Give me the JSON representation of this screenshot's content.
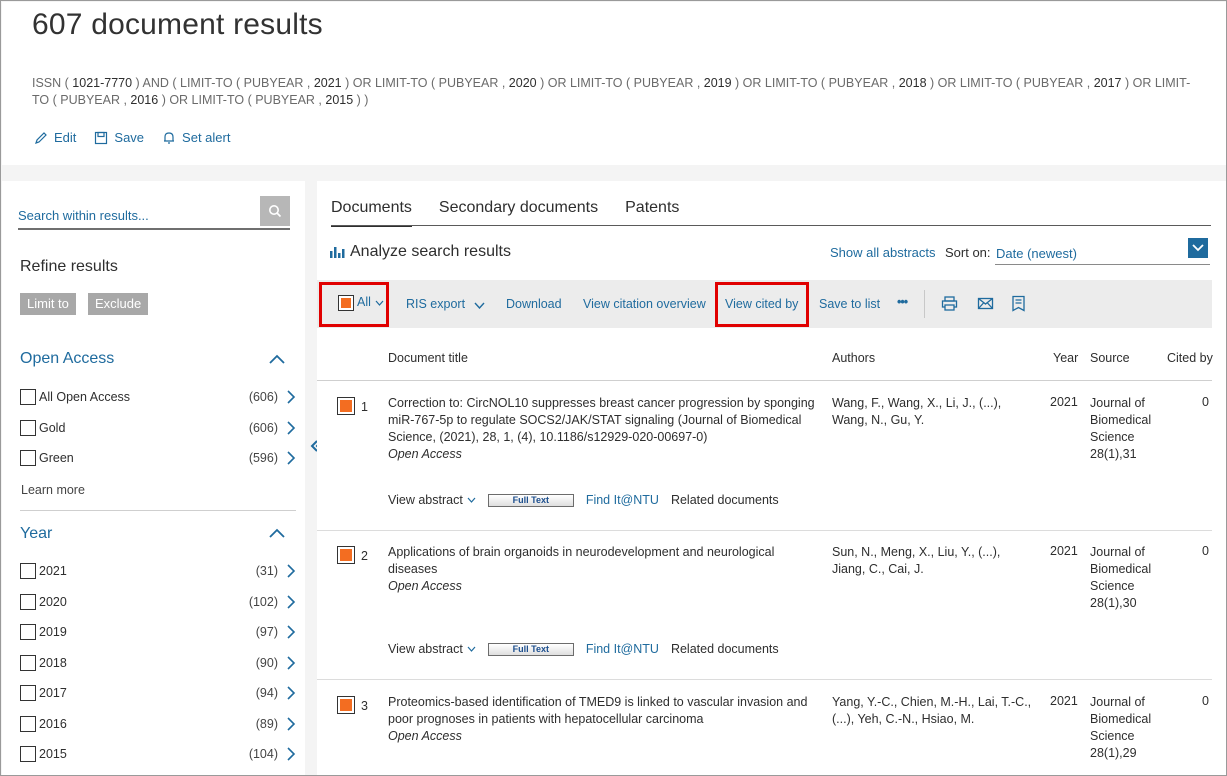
{
  "header": {
    "title": "607 document results",
    "query_parts": [
      {
        "text": "ISSN ( ",
        "strong": false
      },
      {
        "text": "1021-7770",
        "strong": true
      },
      {
        "text": " )  AND  ( LIMIT-TO ( PUBYEAR , ",
        "strong": false
      },
      {
        "text": "2021",
        "strong": true
      },
      {
        "text": " )  OR  LIMIT-TO ( PUBYEAR , ",
        "strong": false
      },
      {
        "text": "2020",
        "strong": true
      },
      {
        "text": " )  OR  LIMIT-TO ( PUBYEAR , ",
        "strong": false
      },
      {
        "text": "2019",
        "strong": true
      },
      {
        "text": " )  OR  LIMIT-TO ( PUBYEAR , ",
        "strong": false
      },
      {
        "text": "2018",
        "strong": true
      },
      {
        "text": " )  OR  LIMIT-TO ( PUBYEAR , ",
        "strong": false
      },
      {
        "text": "2017",
        "strong": true
      },
      {
        "text": " )  OR  LIMIT-TO ( PUBYEAR , ",
        "strong": false
      },
      {
        "text": "2016",
        "strong": true
      },
      {
        "text": " )  OR  LIMIT-TO ( PUBYEAR , ",
        "strong": false
      },
      {
        "text": "2015",
        "strong": true
      },
      {
        "text": " ) )",
        "strong": false
      }
    ],
    "actions": {
      "edit": "Edit",
      "save": "Save",
      "alert": "Set alert"
    }
  },
  "sidebar": {
    "search_placeholder": "Search within results...",
    "refine_title": "Refine results",
    "limit_label": "Limit to",
    "exclude_label": "Exclude",
    "open_access": {
      "title": "Open Access",
      "items": [
        {
          "label": "All Open Access",
          "count": "(606)"
        },
        {
          "label": "Gold",
          "count": "(606)"
        },
        {
          "label": "Green",
          "count": "(596)"
        }
      ],
      "learn_more": "Learn more"
    },
    "year": {
      "title": "Year",
      "items": [
        {
          "label": "2021",
          "count": "(31)"
        },
        {
          "label": "2020",
          "count": "(102)"
        },
        {
          "label": "2019",
          "count": "(97)"
        },
        {
          "label": "2018",
          "count": "(90)"
        },
        {
          "label": "2017",
          "count": "(94)"
        },
        {
          "label": "2016",
          "count": "(89)"
        },
        {
          "label": "2015",
          "count": "(104)"
        }
      ]
    }
  },
  "main": {
    "tabs": [
      "Documents",
      "Secondary documents",
      "Patents"
    ],
    "analyze": "Analyze search results",
    "show_all_abstracts": "Show all abstracts",
    "sort_label": "Sort on:",
    "sort_value": "Date (newest)",
    "toolbar": {
      "all": "All",
      "ris_export": "RIS export",
      "download": "Download",
      "view_citation_overview": "View citation overview",
      "view_cited_by": "View cited by",
      "save_to_list": "Save to list",
      "more": "•••"
    },
    "columns": {
      "title": "Document title",
      "authors": "Authors",
      "year": "Year",
      "source": "Source",
      "cited_by": "Cited by"
    },
    "row_actions": {
      "view_abstract": "View abstract",
      "full_text": "Full Text",
      "find_it": "Find It@NTU",
      "related": "Related documents"
    },
    "results": [
      {
        "num": "1",
        "title": "Correction to: CircNOL10 suppresses breast cancer progression by sponging miR-767-5p to regulate SOCS2/JAK/STAT signaling (Journal of Biomedical Science, (2021), 28, 1, (4), 10.1186/s12929-020-00697-0)",
        "open_access": "Open Access",
        "authors": "Wang, F., Wang, X., Li, J., (...), Wang, N., Gu, Y.",
        "year": "2021",
        "source": "Journal of Biomedical Science 28(1),31",
        "cited_by": "0"
      },
      {
        "num": "2",
        "title": "Applications of brain organoids in neurodevelopment and neurological diseases",
        "open_access": "Open Access",
        "authors": "Sun, N., Meng, X., Liu, Y., (...), Jiang, C., Cai, J.",
        "year": "2021",
        "source": "Journal of Biomedical Science 28(1),30",
        "cited_by": "0"
      },
      {
        "num": "3",
        "title": "Proteomics-based identification of TMED9 is linked to vascular invasion and poor prognoses in patients with hepatocellular carcinoma",
        "open_access": "Open Access",
        "authors": "Yang, Y.-C., Chien, M.-H., Lai, T.-C., (...), Yeh, C.-N., Hsiao, M.",
        "year": "2021",
        "source": "Journal of Biomedical Science 28(1),29",
        "cited_by": "0"
      }
    ]
  },
  "colors": {
    "link": "#1f6b9e",
    "checkbox_fill": "#f36d21",
    "highlight": "#e00000",
    "toolbar_bg": "#ececec"
  }
}
